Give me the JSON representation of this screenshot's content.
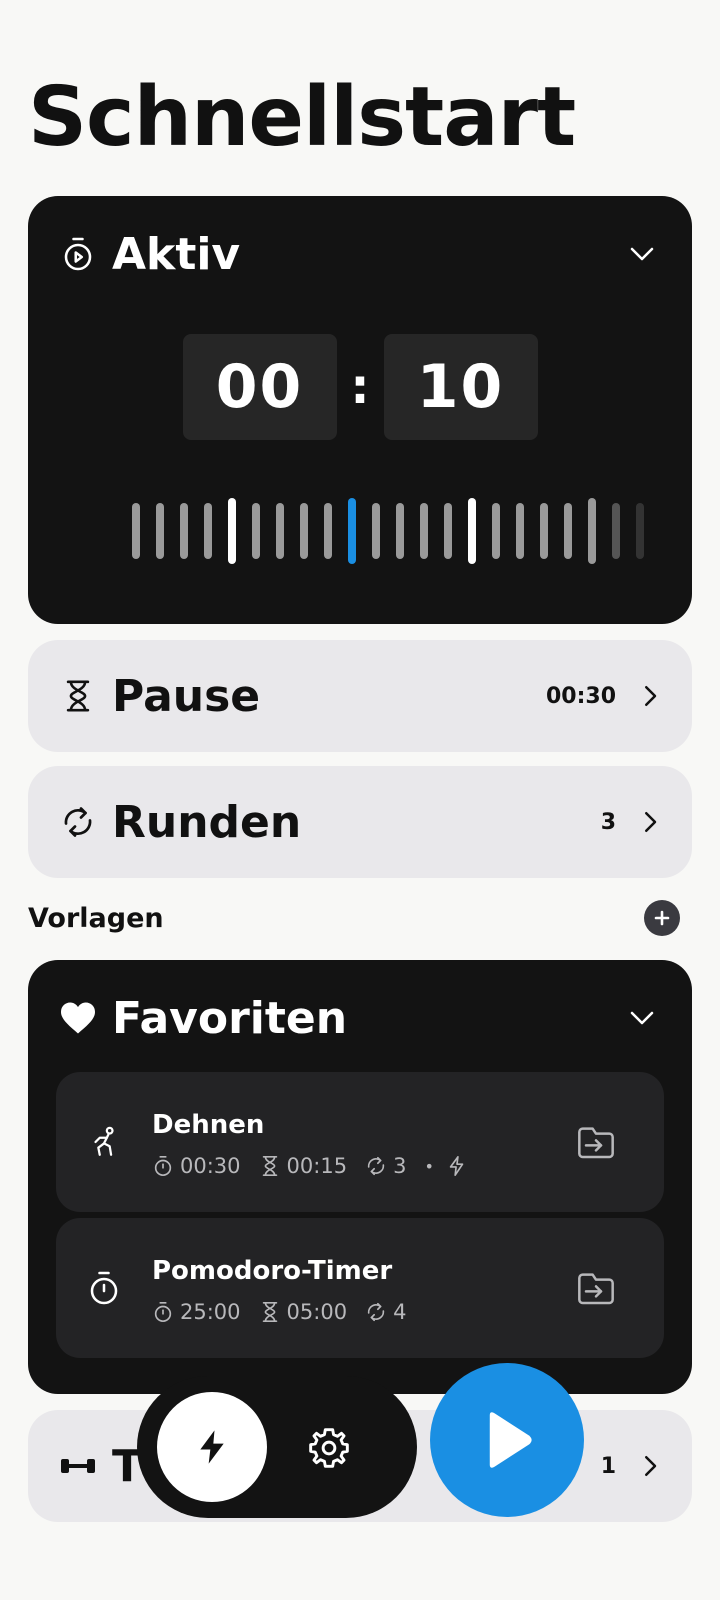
{
  "page": {
    "title": "Schnellstart"
  },
  "active": {
    "title": "Aktiv",
    "minutes": "00",
    "separator": ":",
    "seconds": "10"
  },
  "pause": {
    "label": "Pause",
    "value": "00:30"
  },
  "rounds": {
    "label": "Runden",
    "value": "3"
  },
  "templates": {
    "section_label": "Vorlagen"
  },
  "favorites": {
    "title": "Favoriten",
    "items": [
      {
        "name": "Dehnen",
        "work": "00:30",
        "rest": "00:15",
        "rounds": "3",
        "dot": "•",
        "icon": "stretching-person-icon"
      },
      {
        "name": "Pomodoro-Timer",
        "work": "25:00",
        "rest": "05:00",
        "rounds": "4",
        "icon": "stopwatch-icon"
      }
    ]
  },
  "bottom_row": {
    "label_partial": "T",
    "value": "1"
  },
  "colors": {
    "accent": "#1a8fe3",
    "dark_card": "#131313",
    "light_row": "#e9e8eb",
    "background": "#f8f8f6"
  }
}
